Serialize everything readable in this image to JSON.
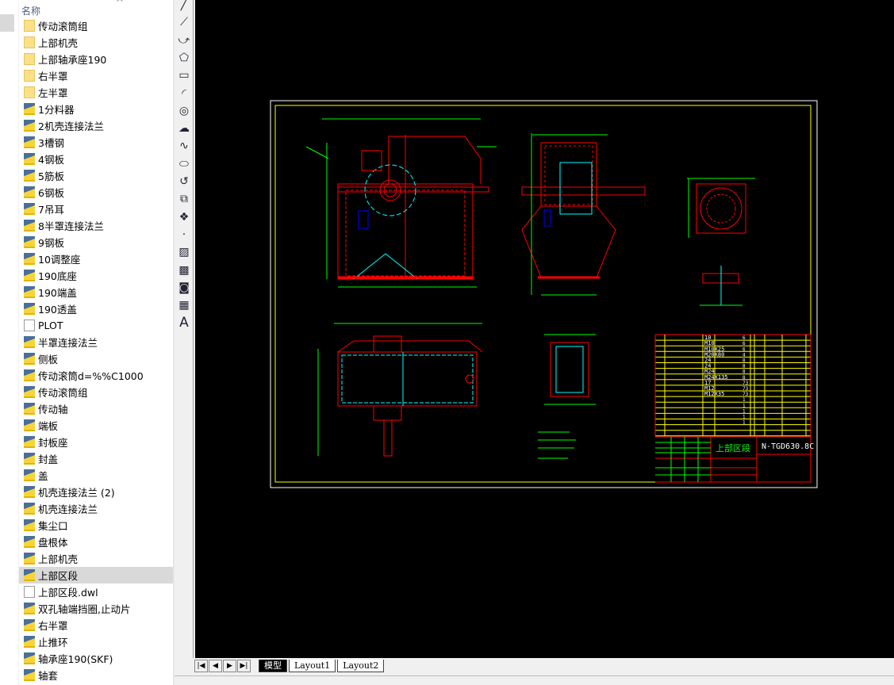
{
  "file_panel": {
    "column_header": "名称",
    "items": [
      {
        "name": "传动滚筒组",
        "type": "folder"
      },
      {
        "name": "上部机壳",
        "type": "folder"
      },
      {
        "name": "上部轴承座190",
        "type": "folder"
      },
      {
        "name": "右半罩",
        "type": "folder"
      },
      {
        "name": "左半罩",
        "type": "folder"
      },
      {
        "name": "1分料器",
        "type": "dwg"
      },
      {
        "name": "2机壳连接法兰",
        "type": "dwg"
      },
      {
        "name": "3槽钢",
        "type": "dwg"
      },
      {
        "name": "4钢板",
        "type": "dwg"
      },
      {
        "name": "5筋板",
        "type": "dwg"
      },
      {
        "name": "6钢板",
        "type": "dwg"
      },
      {
        "name": "7吊耳",
        "type": "dwg"
      },
      {
        "name": "8半罩连接法兰",
        "type": "dwg"
      },
      {
        "name": "9钢板",
        "type": "dwg"
      },
      {
        "name": "10调整座",
        "type": "dwg"
      },
      {
        "name": "190底座",
        "type": "dwg"
      },
      {
        "name": "190端盖",
        "type": "dwg"
      },
      {
        "name": "190透盖",
        "type": "dwg"
      },
      {
        "name": "PLOT",
        "type": "file"
      },
      {
        "name": "半罩连接法兰",
        "type": "dwg"
      },
      {
        "name": "侧板",
        "type": "dwg"
      },
      {
        "name": "传动滚筒d=%%C1000",
        "type": "dwg"
      },
      {
        "name": "传动滚筒组",
        "type": "dwg"
      },
      {
        "name": "传动轴",
        "type": "dwg"
      },
      {
        "name": "端板",
        "type": "dwg"
      },
      {
        "name": "封板座",
        "type": "dwg"
      },
      {
        "name": "封盖",
        "type": "dwg"
      },
      {
        "name": "盖",
        "type": "dwg"
      },
      {
        "name": "机壳连接法兰 (2)",
        "type": "dwg"
      },
      {
        "name": "机壳连接法兰",
        "type": "dwg"
      },
      {
        "name": "集尘口",
        "type": "dwg"
      },
      {
        "name": "盘根体",
        "type": "dwg"
      },
      {
        "name": "上部机壳",
        "type": "dwg"
      },
      {
        "name": "上部区段",
        "type": "dwg",
        "selected": true
      },
      {
        "name": "上部区段.dwl",
        "type": "file"
      },
      {
        "name": "双孔轴端挡圈,止动片",
        "type": "dwg"
      },
      {
        "name": "右半罩",
        "type": "dwg"
      },
      {
        "name": "止推环",
        "type": "dwg"
      },
      {
        "name": "轴承座190(SKF)",
        "type": "dwg"
      },
      {
        "name": "轴套",
        "type": "dwg"
      }
    ]
  },
  "toolbar": {
    "tools": [
      "line-icon",
      "construction-line-icon",
      "polyline-icon",
      "polygon-icon",
      "rectangle-icon",
      "arc-icon",
      "circle-icon",
      "revision-cloud-icon",
      "spline-icon",
      "ellipse-icon",
      "ellipse-arc-icon",
      "insert-block-icon",
      "make-block-icon",
      "point-icon",
      "hatch-icon",
      "gradient-icon",
      "region-icon",
      "table-icon",
      "multiline-text-icon"
    ],
    "text_tool_label": "A"
  },
  "drawing": {
    "title": "上部区段",
    "drawing_number": "N-TGD630.8C",
    "parts_sizes": [
      "10",
      "M10",
      "M10X25",
      "M20X80",
      "24",
      "24",
      "M24",
      "M24X135",
      "17",
      "M12",
      "M12X35"
    ],
    "parts_qty": [
      "6",
      "6",
      "6",
      "4",
      "8",
      "8",
      "8",
      "8",
      "73",
      "73",
      "73",
      "1",
      "1",
      "1",
      "1",
      "1"
    ],
    "colors": {
      "background": "#000000",
      "frame": "#ffffff",
      "border": "#ffff00",
      "part": "#ff0000",
      "dimension": "#00ff00",
      "center": "#00ffff",
      "hidden": "#0000ff"
    }
  },
  "layout_tabs": {
    "nav": [
      "first",
      "prev",
      "next",
      "last"
    ],
    "nav_glyphs": [
      "|◀",
      "◀",
      "▶",
      "▶|"
    ],
    "tabs": [
      "模型",
      "Layout1",
      "Layout2"
    ],
    "active": "模型"
  }
}
